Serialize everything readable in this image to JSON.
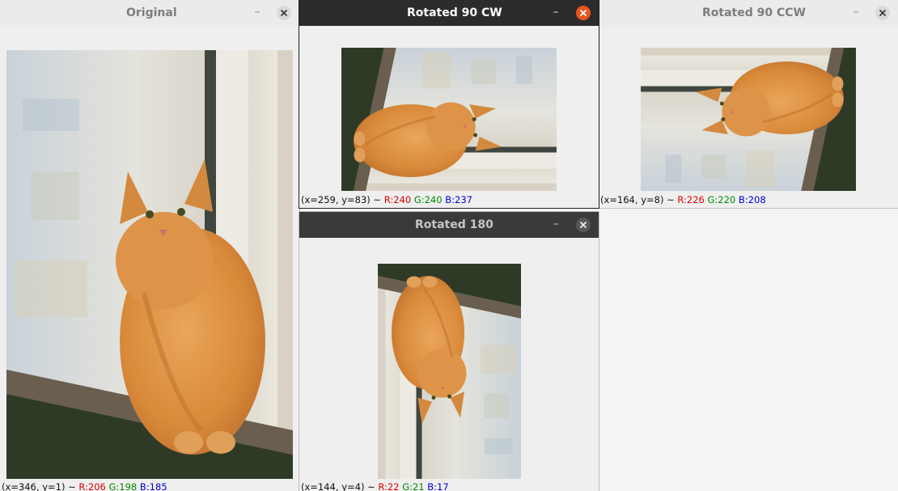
{
  "windows": {
    "original": {
      "title": "Original",
      "status": {
        "prefix": "(x=346, y=1) ~ ",
        "r": "R:206",
        "g": "G:198",
        "b": "B:185"
      }
    },
    "cw": {
      "title": "Rotated 90 CW",
      "status": {
        "prefix": "(x=259, y=83) ~ ",
        "r": "R:240",
        "g": "G:240",
        "b": "B:237"
      }
    },
    "ccw": {
      "title": "Rotated 90 CCW",
      "status": {
        "prefix": "(x=164, y=8) ~ ",
        "r": "R:226",
        "g": "G:220",
        "b": "B:208"
      }
    },
    "r180": {
      "title": "Rotated 180",
      "status": {
        "prefix": "(x=144, y=4) ~ ",
        "r": "R:22",
        "g": "G:21",
        "b": "B:17"
      }
    }
  },
  "controls": {
    "minimize_glyph": "–"
  },
  "icons": {
    "close": "close-icon",
    "minimize": "minimize-icon",
    "image": "cat-photo"
  },
  "colors": {
    "accent": "#e95420",
    "status_r": "#e00000",
    "status_g": "#008a00",
    "status_b": "#0000d8"
  }
}
